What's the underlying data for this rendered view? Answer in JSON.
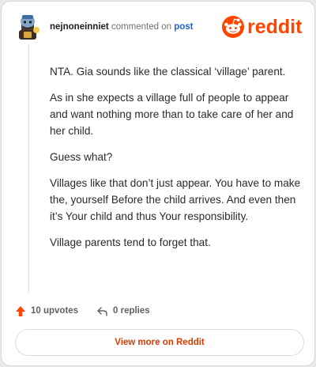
{
  "header": {
    "username": "nejnoneinniet",
    "action": "commented on",
    "post_link": "post",
    "brand": "reddit"
  },
  "comment": {
    "paragraphs": [
      "NTA. Gia sounds like the classical ‘village’ parent.",
      "As in she expects a village full of people to appear and want nothing more than to take care of her and her child.",
      "Guess what?",
      "Villages like that don’t just appear. You have to make the, yourself Before the child arrives. And even then it’s Your child and thus Your responsibility.",
      "Village parents tend to forget that."
    ]
  },
  "actions": {
    "upvotes_label": "10 upvotes",
    "replies_label": "0 replies"
  },
  "footer": {
    "view_more_label": "View more on Reddit"
  },
  "colors": {
    "brand": "#ff4500",
    "link": "#1b63c9",
    "button_text": "#d93a00"
  },
  "icons": {
    "avatar": "snoo-avatar",
    "upvote": "upvote-arrow-icon",
    "reply": "reply-icon",
    "logo": "reddit-logo"
  }
}
